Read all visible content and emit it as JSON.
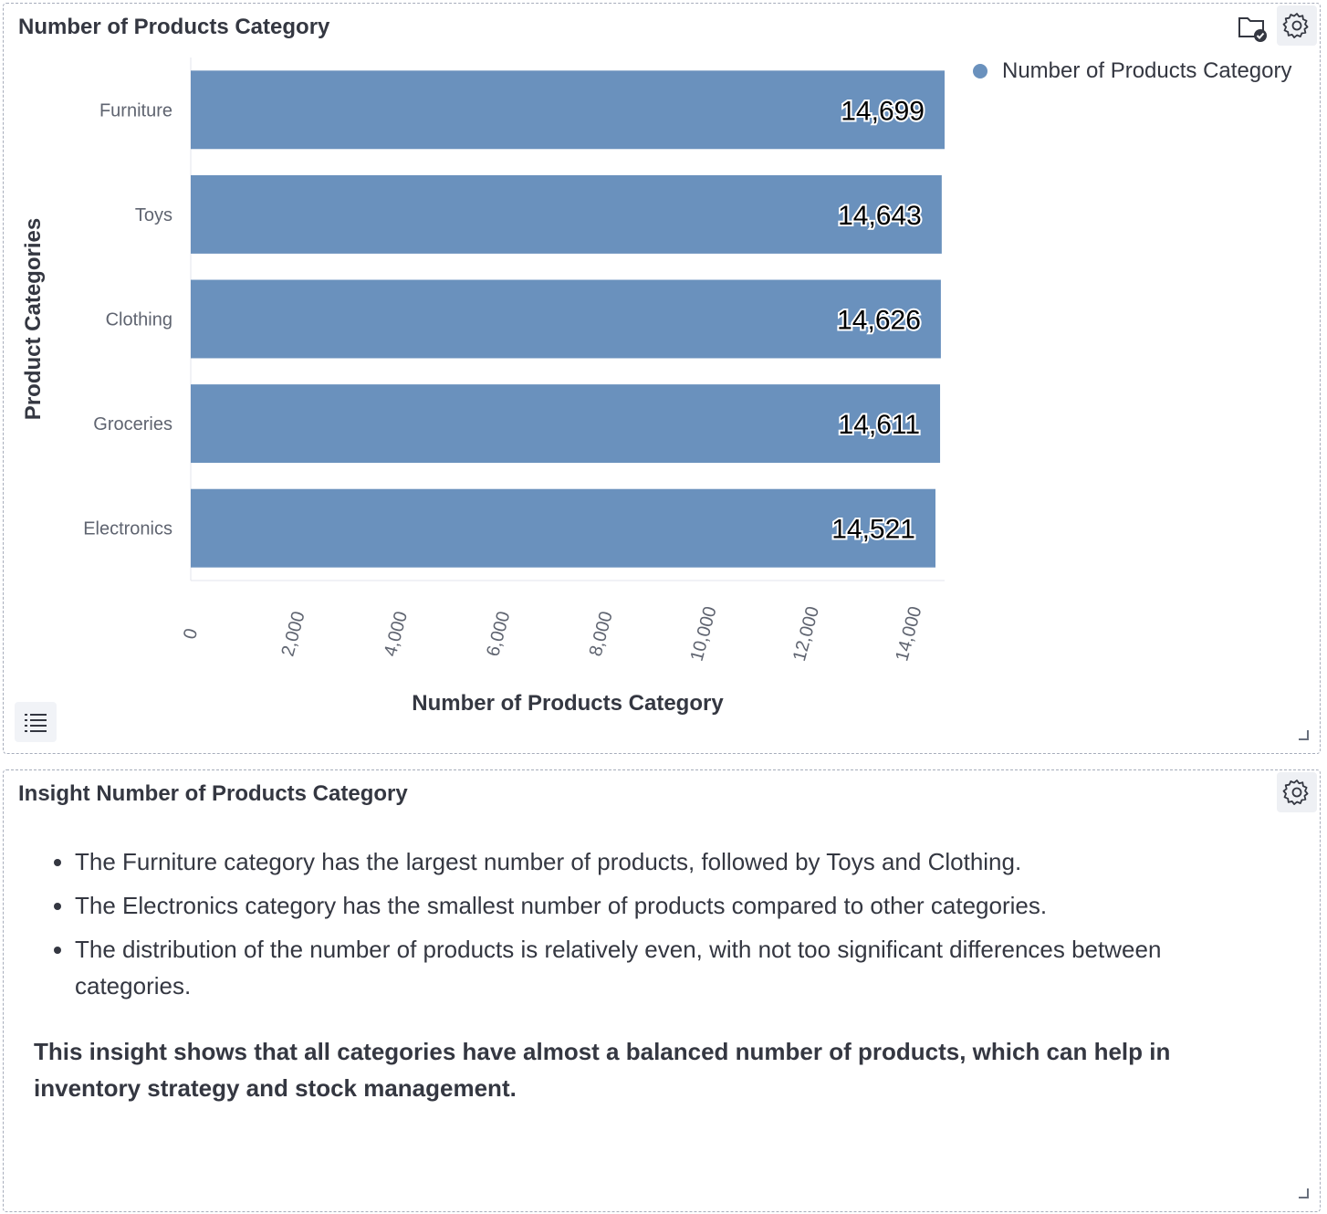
{
  "chart_panel": {
    "title": "Number of Products Category",
    "legend_label": "Number of Products Category"
  },
  "chart_data": {
    "type": "bar",
    "orientation": "horizontal",
    "categories": [
      "Furniture",
      "Toys",
      "Clothing",
      "Groceries",
      "Electronics"
    ],
    "series": [
      {
        "name": "Number of Products Category",
        "values": [
          14699,
          14643,
          14626,
          14611,
          14521
        ]
      }
    ],
    "data_labels": [
      "14,699",
      "14,643",
      "14,626",
      "14,611",
      "14,521"
    ],
    "xticks": [
      "0",
      "2,000",
      "4,000",
      "6,000",
      "8,000",
      "10,000",
      "12,000",
      "14,000"
    ],
    "xlabel": "Number of Products Category",
    "ylabel": "Product Categories",
    "xlim": [
      0,
      14699
    ],
    "grid": false,
    "legend_position": "top-right",
    "bar_color": "#6a91bd"
  },
  "insight_panel": {
    "title": "Insight Number of Products Category",
    "bullets": [
      "The Furniture category has the largest number of products, followed by Toys and Clothing.",
      "The Electronics category has the smallest number of products compared to other categories.",
      "The distribution of the number of products is relatively even, with not too significant differences between categories."
    ],
    "summary": "This insight shows that all categories have almost a balanced number of products, which can help in inventory strategy and stock management."
  },
  "icons": {
    "folder_check": "folder-check-icon",
    "gear": "gear-icon",
    "list": "list-icon",
    "resize": "resize-handle-icon"
  }
}
